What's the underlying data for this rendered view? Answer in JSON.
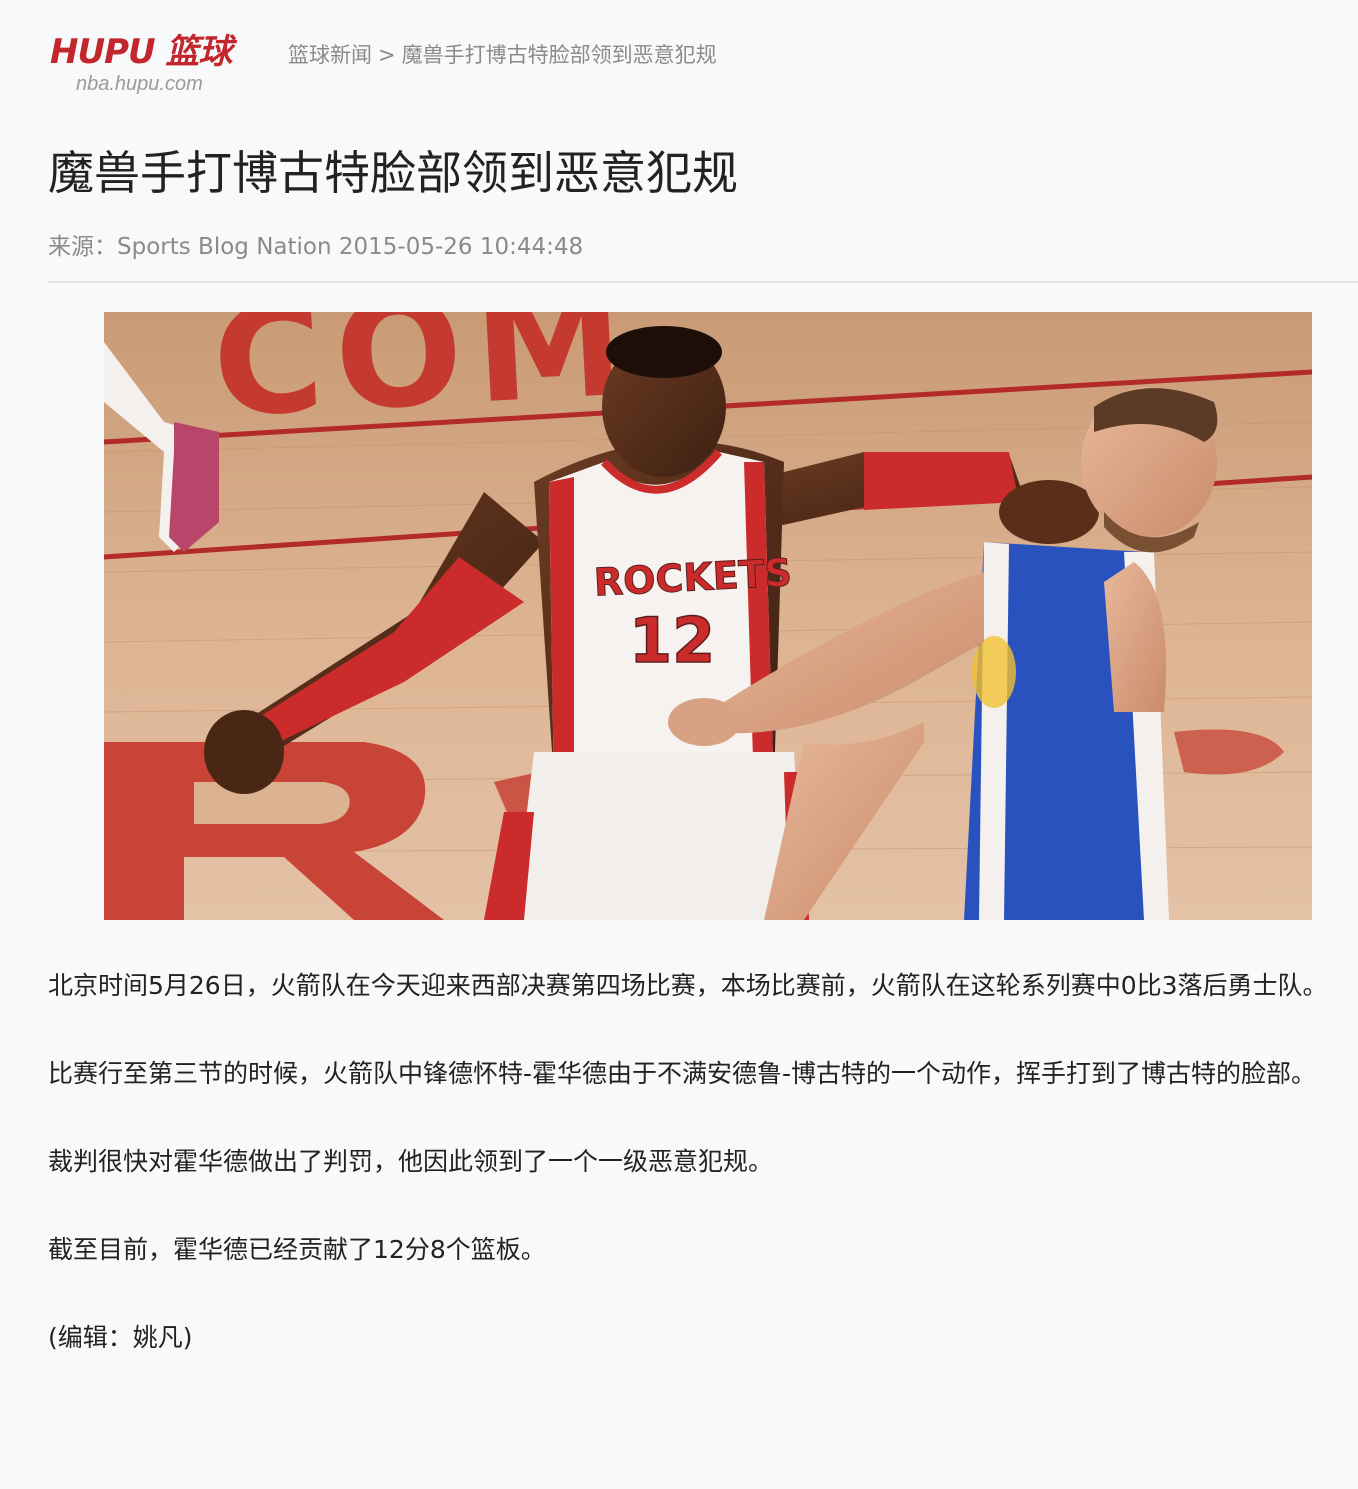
{
  "header": {
    "logo_text": "HUPU 篮球",
    "logo_subtext": "nba.hupu.com",
    "breadcrumb": {
      "section": "篮球新闻",
      "separator": ">",
      "current": "魔兽手打博古特脸部领到恶意犯规"
    }
  },
  "article": {
    "title": "魔兽手打博古特脸部领到恶意犯规",
    "meta": "来源：Sports Blog Nation 2015-05-26 10:44:48",
    "photo": {
      "jersey_text": "ROCKETS",
      "jersey_number": "12",
      "court_text": "COM"
    },
    "paragraphs": [
      "北京时间5月26日，火箭队在今天迎来西部决赛第四场比赛，本场比赛前，火箭队在这轮系列赛中0比3落后勇士队。",
      "比赛行至第三节的时候，火箭队中锋德怀特-霍华德由于不满安德鲁-博古特的一个动作，挥手打到了博古特的脸部。",
      "裁判很快对霍华德做出了判罚，他因此领到了一个一级恶意犯规。",
      "截至目前，霍华德已经贡献了12分8个篮板。",
      "(编辑：姚凡)"
    ]
  },
  "colors": {
    "brand_red": "#c1272d",
    "rockets_red": "#cc2b2b",
    "warriors_blue": "#2a52be",
    "court_wood": "#d9b08c"
  }
}
